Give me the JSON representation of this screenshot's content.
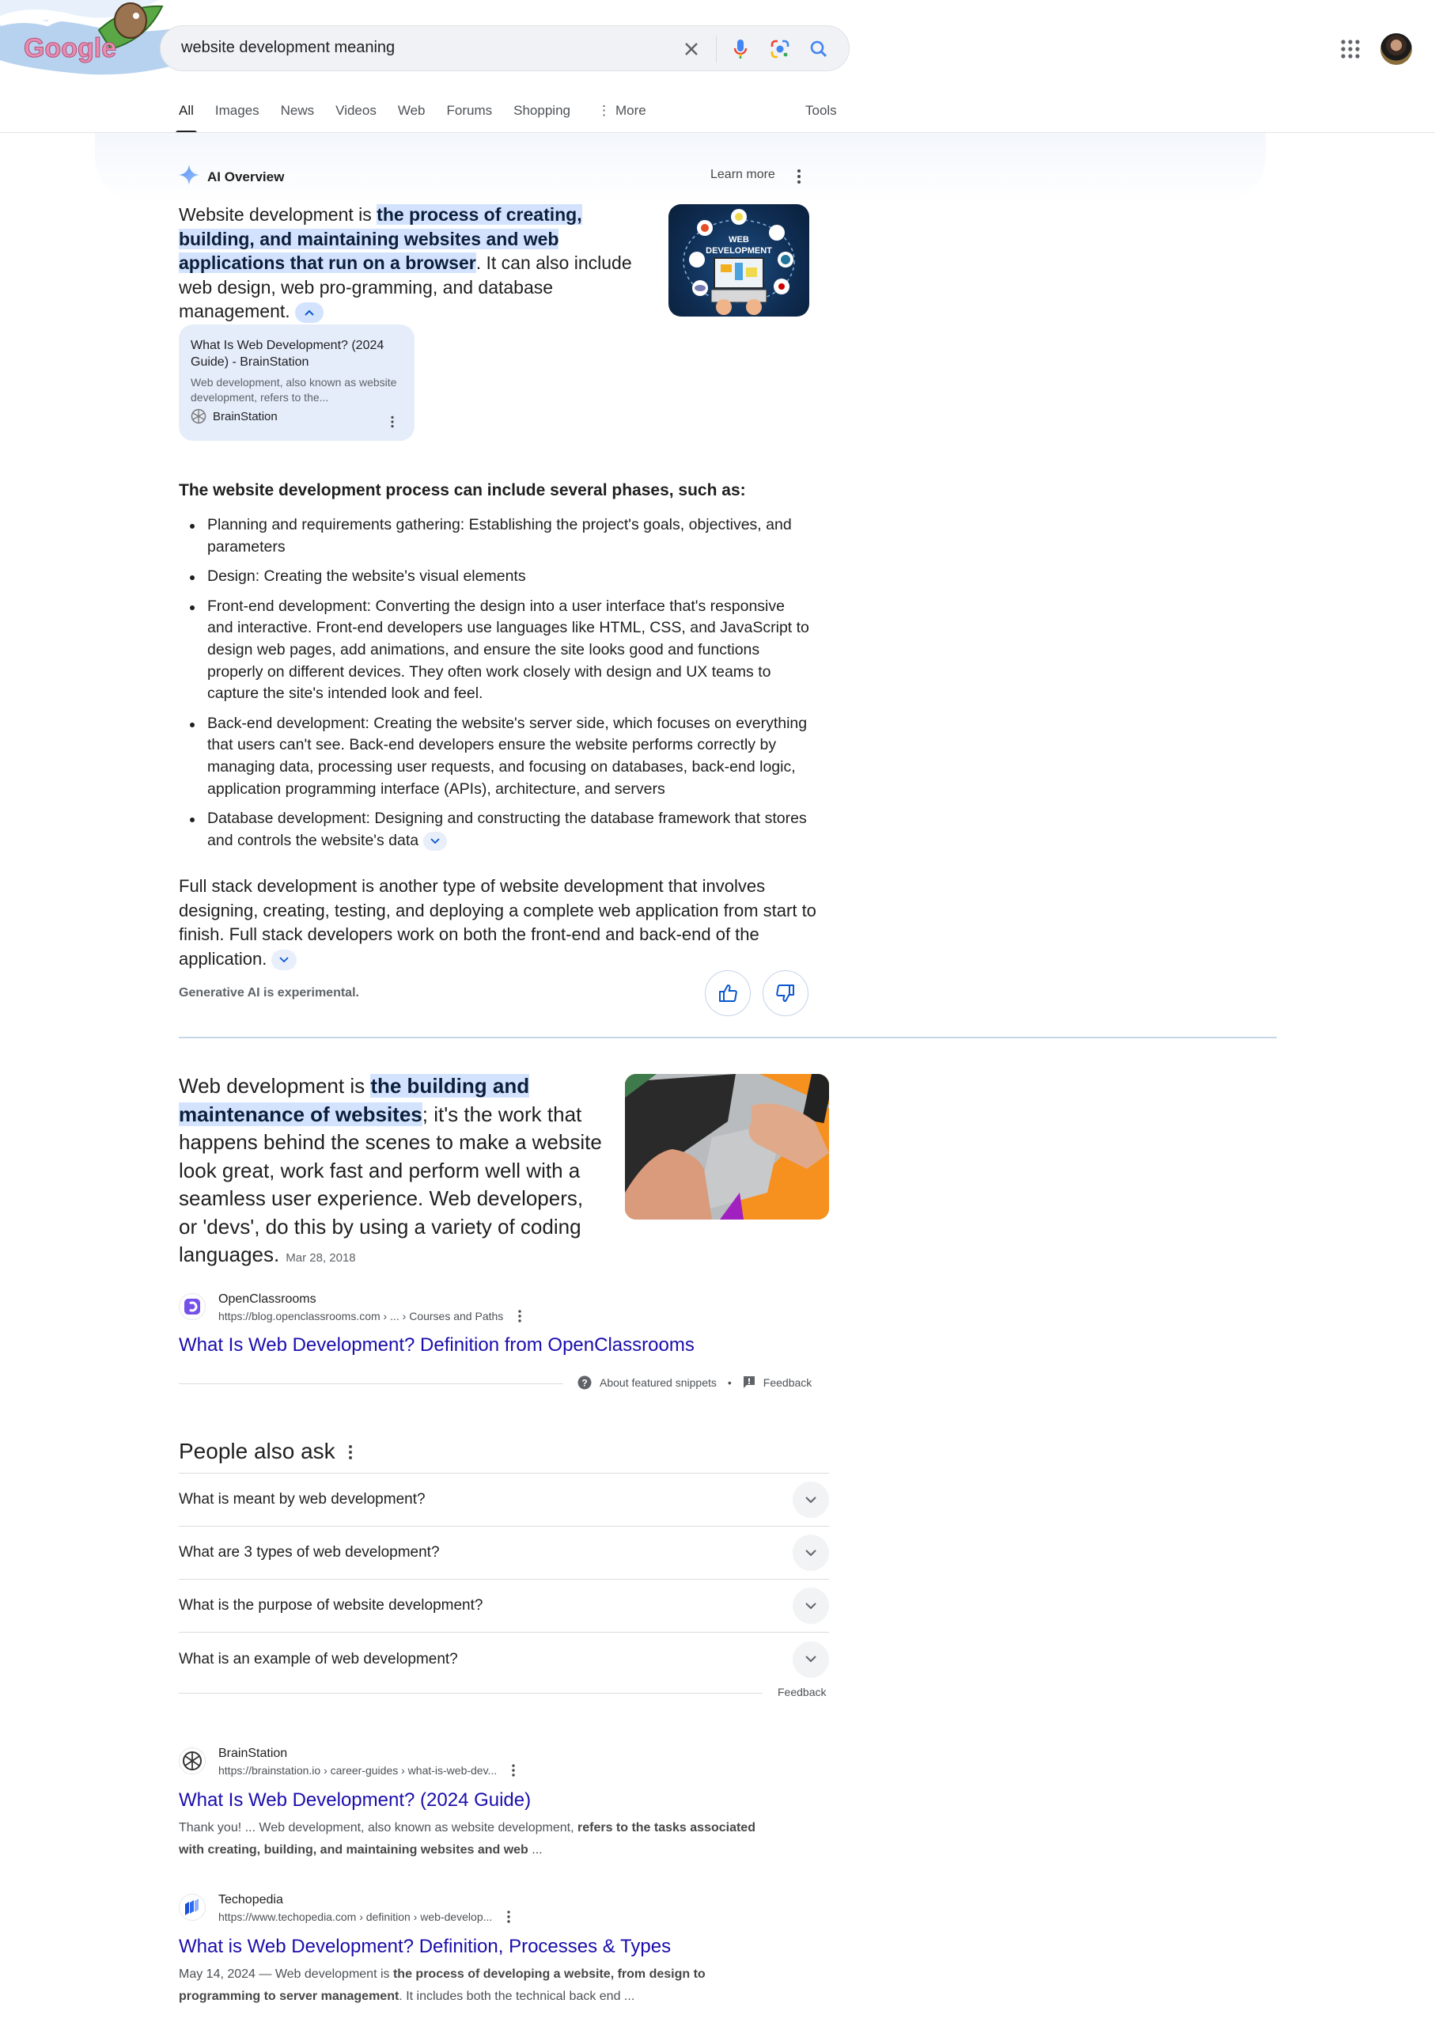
{
  "header": {
    "logo_label": "Google",
    "search_query": "website development meaning",
    "icons": [
      "clear-icon",
      "microphone-icon",
      "lens-icon",
      "search-icon",
      "apps-grid-icon",
      "account-avatar"
    ]
  },
  "tabs": [
    {
      "label": "All",
      "active": true
    },
    {
      "label": "Images"
    },
    {
      "label": "News"
    },
    {
      "label": "Videos"
    },
    {
      "label": "Web"
    },
    {
      "label": "Forums"
    },
    {
      "label": "Shopping"
    },
    {
      "label": "More"
    }
  ],
  "tools_label": "Tools",
  "ai_overview": {
    "label": "AI Overview",
    "learn_more": "Learn more",
    "lead_prefix": "Website development is ",
    "lead_highlight": "the process of creating, building, and maintaining websites and web applications that run on a browser",
    "lead_suffix": ". It can also include web design, web pro-gramming, and database management.",
    "image_text_1": "WEB",
    "image_text_2": "DEVELOPMENT",
    "source_card": {
      "title": "What Is Web Development? (2024 Guide) - BrainStation",
      "snippet": "Web development, also known as website development, refers to the...",
      "site": "BrainStation"
    },
    "phases_heading": "The website development process can include several phases, such as:",
    "phases": [
      "Planning and requirements gathering: Establishing the project's goals, objectives, and parameters",
      "Design: Creating the website's visual elements",
      "Front-end development: Converting the design into a user interface that's responsive and interactive. Front-end developers use languages like HTML, CSS, and JavaScript to design web pages, add animations, and ensure the site looks good and functions properly on different devices. They often work closely with design and UX teams to capture the site's intended look and feel.",
      "Back-end development: Creating the website's server side, which focuses on everything that users can't see. Back-end developers ensure the website performs correctly by managing data, processing user requests, and focusing on databases, back-end logic, application programming interface (APIs), architecture, and servers",
      "Database development: Designing and constructing the database framework that stores and controls the website's data"
    ],
    "full_stack": "Full stack development is another type of website development that involves designing, creating, testing, and deploying a complete web application from start to finish. Full stack developers work on both the front-end and back-end of the application.",
    "disclaimer": "Generative AI is experimental."
  },
  "featured_snippet": {
    "prefix": "Web development is ",
    "highlight": "the building and maintenance of websites",
    "suffix": "; it's the work that happens behind the scenes to make a website look great, work fast and perform well with a seamless user experience. Web developers, or 'devs', do this by using a variety of coding languages.",
    "date": "Mar 28, 2018",
    "site_name": "OpenClassrooms",
    "url": "https://blog.openclassrooms.com › ... › Courses and Paths",
    "title": "What Is Web Development? Definition from OpenClassrooms",
    "about_label": "About featured snippets",
    "feedback_label": "Feedback"
  },
  "people_also_ask": {
    "title": "People also ask",
    "questions": [
      "What is meant by web development?",
      "What are 3 types of web development?",
      "What is the purpose of website development?",
      "What is an example of web development?"
    ],
    "feedback_label": "Feedback"
  },
  "results": [
    {
      "site_name": "BrainStation",
      "url": "https://brainstation.io › career-guides › what-is-web-dev...",
      "title": "What Is Web Development? (2024 Guide)",
      "snippet_plain": "Thank you! ... Web development, also known as website development, ",
      "snippet_bold": "refers to the tasks associated with creating, building, and maintaining websites and web",
      "snippet_end": " ..."
    },
    {
      "site_name": "Techopedia",
      "url": "https://www.techopedia.com › definition › web-develop...",
      "title": "What is Web Development? Definition, Processes & Types",
      "snippet_plain": "May 14, 2024 — Web development is ",
      "snippet_bold": "the process of developing a website, from design to programming to server management",
      "snippet_end": ". It includes both the technical back end ..."
    }
  ]
}
